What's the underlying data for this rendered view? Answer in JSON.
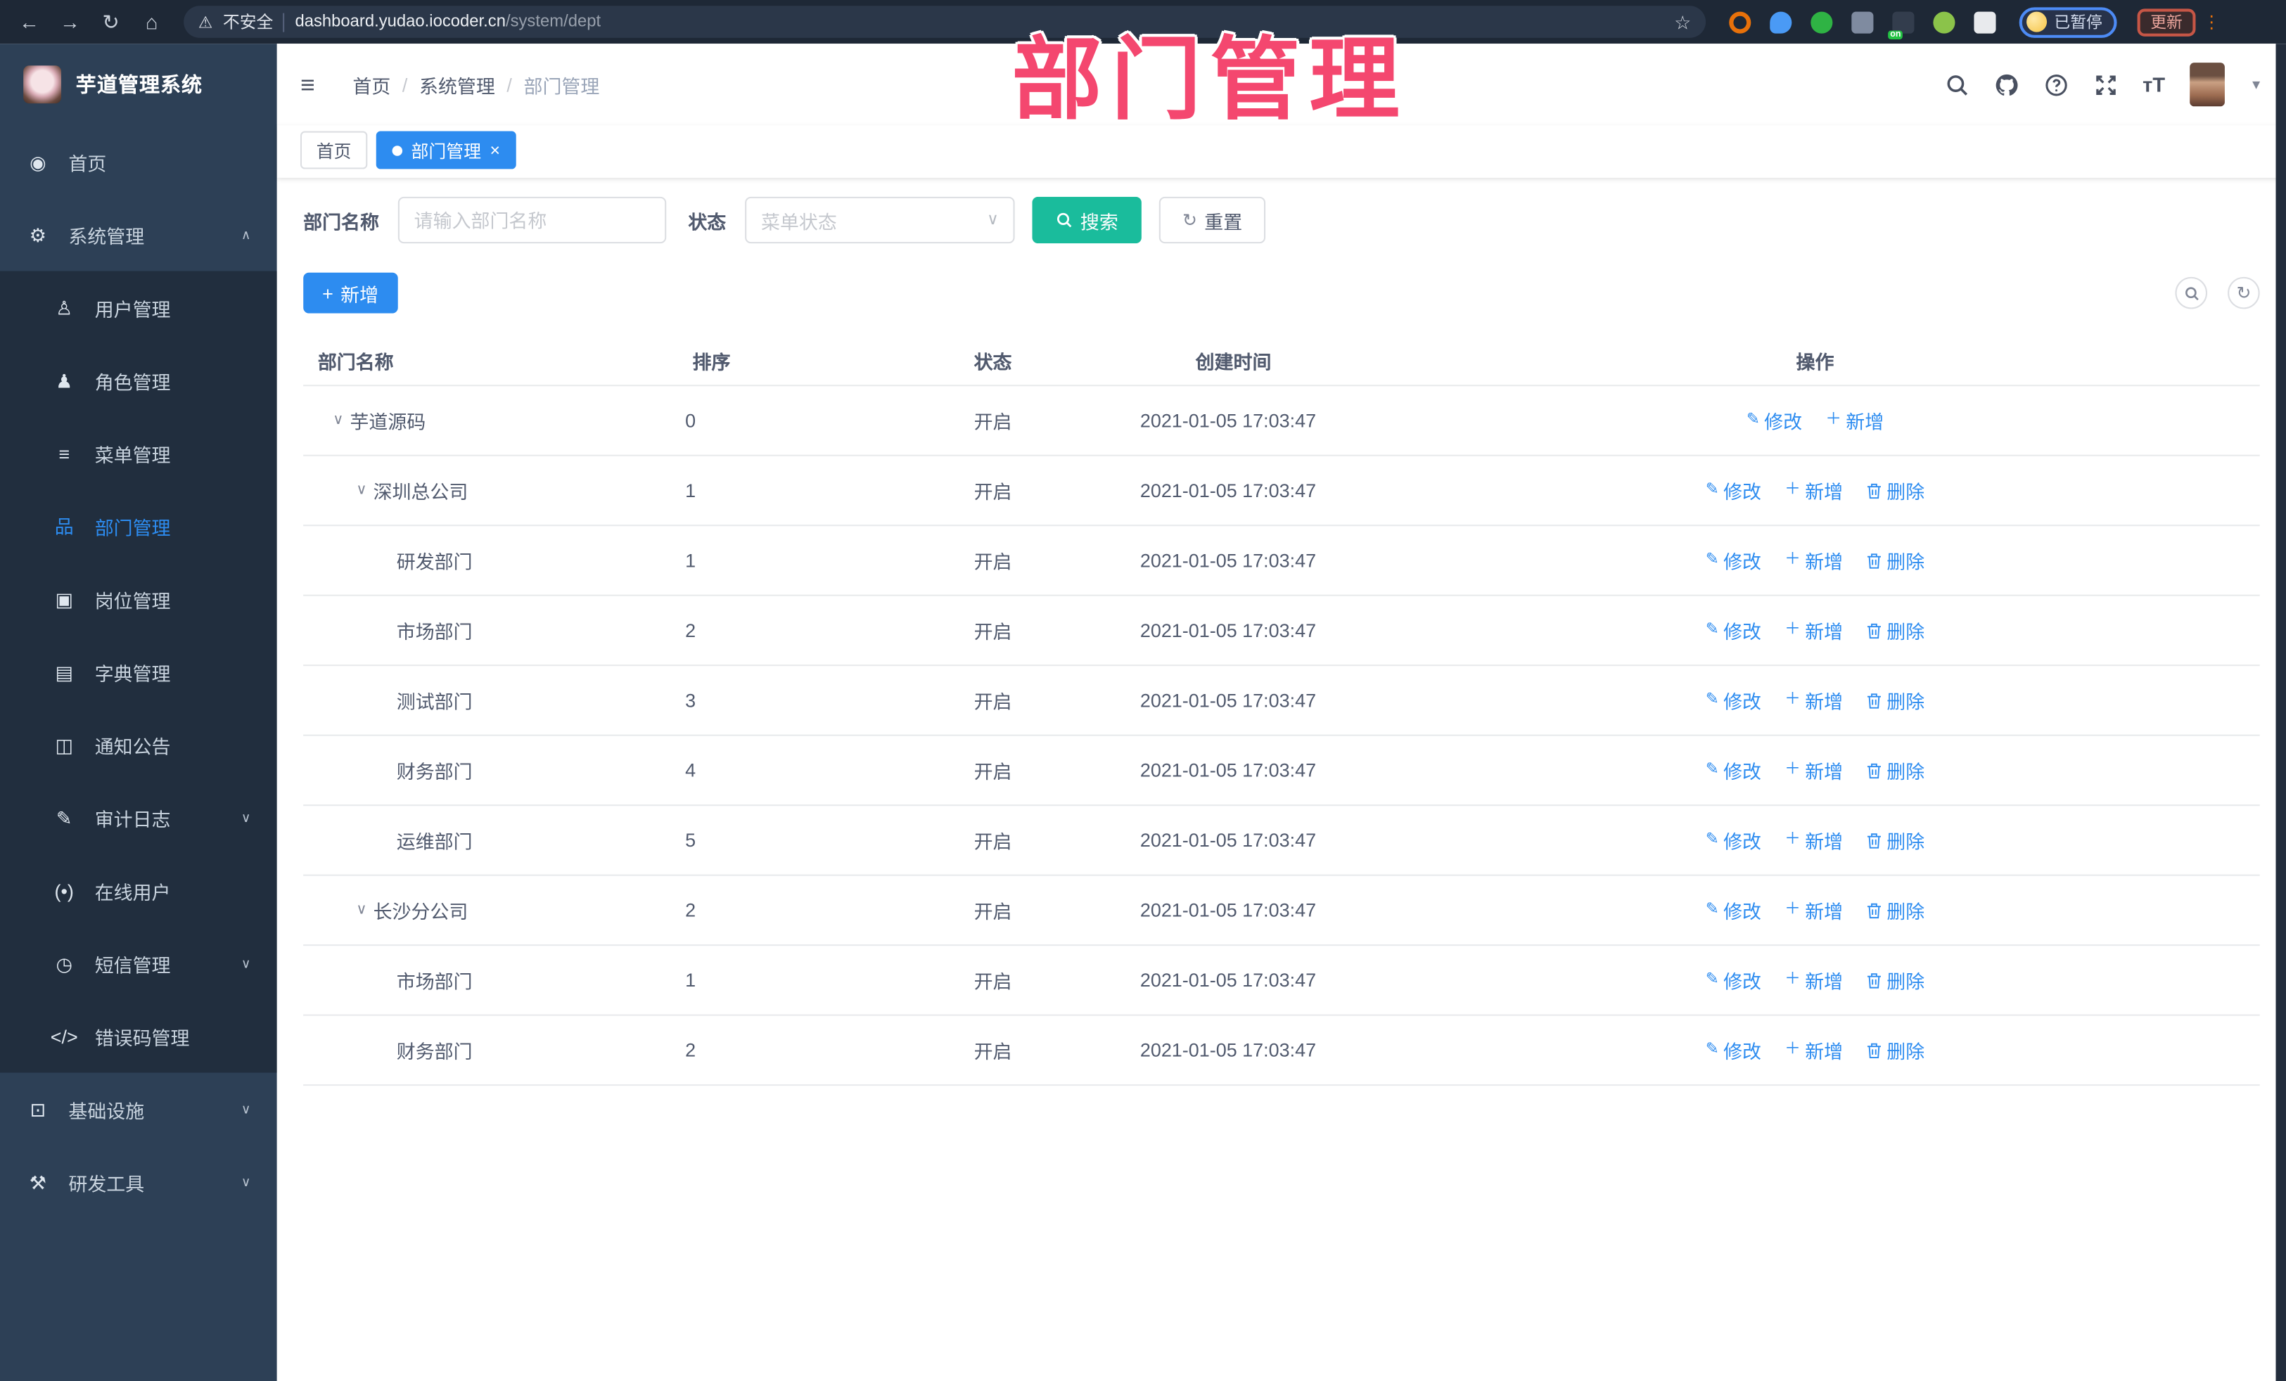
{
  "colors": {
    "accent_blue": "#2d8cf0",
    "search_teal": "#1abc9c",
    "annotation_pink": "#f4476f",
    "sidebar_bg": "#2d4056",
    "submenu_bg": "#212e3e",
    "browser_bar_bg": "#1e2836"
  },
  "annotation": {
    "title": "部门管理"
  },
  "browser": {
    "nav_icons": [
      "back-icon",
      "forward-icon",
      "reload-icon",
      "home-icon"
    ],
    "secure_label": "不安全",
    "url_host": "dashboard.yudao.iocoder.cn",
    "url_path": "/system/dept",
    "bookmark_icon": "star-icon",
    "extensions": [
      {
        "name": "extension-icon-orange-ring",
        "color": "#e8710a",
        "shape": "ring"
      },
      {
        "name": "extension-icon-blue-drop",
        "color": "#4a9af5",
        "shape": "drop"
      },
      {
        "name": "extension-icon-green-check",
        "color": "#2fb344",
        "shape": "circle"
      },
      {
        "name": "extension-icon-grid",
        "color": "#7f8ba0",
        "shape": "square"
      },
      {
        "name": "extension-icon-dark-on",
        "color": "#333d4d",
        "shape": "badge",
        "badge": "on"
      },
      {
        "name": "extension-icon-green-leaf",
        "color": "#8bc34a",
        "shape": "circle"
      },
      {
        "name": "extension-icon-puzzle",
        "color": "#e8eaed",
        "shape": "square"
      }
    ],
    "paused_badge": "已暂停",
    "update_label": "更新"
  },
  "sidebar": {
    "logo_title": "芋道管理系统",
    "items": [
      {
        "name": "home",
        "label": "首页",
        "icon": "dashboard-icon",
        "type": "top"
      },
      {
        "name": "system",
        "label": "系统管理",
        "icon": "gear-icon",
        "type": "top",
        "chevron": "up"
      },
      {
        "name": "user",
        "label": "用户管理",
        "icon": "user-icon",
        "type": "sub"
      },
      {
        "name": "role",
        "label": "角色管理",
        "icon": "role-icon",
        "type": "sub"
      },
      {
        "name": "menu",
        "label": "菜单管理",
        "icon": "menu-list-icon",
        "type": "sub"
      },
      {
        "name": "dept",
        "label": "部门管理",
        "icon": "org-chart-icon",
        "type": "sub",
        "active": true
      },
      {
        "name": "post",
        "label": "岗位管理",
        "icon": "post-icon",
        "type": "sub"
      },
      {
        "name": "dict",
        "label": "字典管理",
        "icon": "dict-icon",
        "type": "sub"
      },
      {
        "name": "notice",
        "label": "通知公告",
        "icon": "announcement-icon",
        "type": "sub"
      },
      {
        "name": "audit-log",
        "label": "审计日志",
        "icon": "audit-log-icon",
        "type": "sub",
        "chevron": "down"
      },
      {
        "name": "online-user",
        "label": "在线用户",
        "icon": "online-user-icon",
        "type": "sub"
      },
      {
        "name": "sms",
        "label": "短信管理",
        "icon": "sms-icon",
        "type": "sub",
        "chevron": "down"
      },
      {
        "name": "error-code",
        "label": "错误码管理",
        "icon": "code-icon",
        "type": "sub"
      },
      {
        "name": "infra",
        "label": "基础设施",
        "icon": "infrastructure-icon",
        "type": "top",
        "chevron": "down"
      },
      {
        "name": "dev-tool",
        "label": "研发工具",
        "icon": "toolbox-icon",
        "type": "top",
        "chevron": "down"
      }
    ]
  },
  "header": {
    "breadcrumb": [
      "首页",
      "系统管理",
      "部门管理"
    ],
    "right_icons": [
      "search-icon",
      "github-icon",
      "help-icon",
      "fullscreen-icon",
      "font-size-icon"
    ]
  },
  "tabs": [
    {
      "label": "首页",
      "active": false,
      "closable": false
    },
    {
      "label": "部门管理",
      "active": true,
      "closable": true
    }
  ],
  "filters": {
    "name_label": "部门名称",
    "name_placeholder": "请输入部门名称",
    "status_label": "状态",
    "status_placeholder": "菜单状态",
    "search_label": "搜索",
    "reset_label": "重置"
  },
  "toolbar": {
    "add_label": "新增",
    "icons": [
      "search-icon",
      "refresh-icon"
    ]
  },
  "table": {
    "columns": [
      "部门名称",
      "排序",
      "状态",
      "创建时间",
      "操作"
    ],
    "rows": [
      {
        "name": "芋道源码",
        "level": 0,
        "expandable": true,
        "order": "0",
        "status": "开启",
        "created": "2021-01-05 17:03:47",
        "actions": [
          {
            "label": "修改",
            "icon": "edit-icon"
          },
          {
            "label": "新增",
            "icon": "plus-icon"
          }
        ]
      },
      {
        "name": "深圳总公司",
        "level": 1,
        "expandable": true,
        "order": "1",
        "status": "开启",
        "created": "2021-01-05 17:03:47",
        "actions": [
          {
            "label": "修改",
            "icon": "edit-icon"
          },
          {
            "label": "新增",
            "icon": "plus-icon"
          },
          {
            "label": "删除",
            "icon": "trash-icon"
          }
        ]
      },
      {
        "name": "研发部门",
        "level": 2,
        "expandable": false,
        "order": "1",
        "status": "开启",
        "created": "2021-01-05 17:03:47",
        "actions": [
          {
            "label": "修改",
            "icon": "edit-icon"
          },
          {
            "label": "新增",
            "icon": "plus-icon"
          },
          {
            "label": "删除",
            "icon": "trash-icon"
          }
        ]
      },
      {
        "name": "市场部门",
        "level": 2,
        "expandable": false,
        "order": "2",
        "status": "开启",
        "created": "2021-01-05 17:03:47",
        "actions": [
          {
            "label": "修改",
            "icon": "edit-icon"
          },
          {
            "label": "新增",
            "icon": "plus-icon"
          },
          {
            "label": "删除",
            "icon": "trash-icon"
          }
        ]
      },
      {
        "name": "测试部门",
        "level": 2,
        "expandable": false,
        "order": "3",
        "status": "开启",
        "created": "2021-01-05 17:03:47",
        "actions": [
          {
            "label": "修改",
            "icon": "edit-icon"
          },
          {
            "label": "新增",
            "icon": "plus-icon"
          },
          {
            "label": "删除",
            "icon": "trash-icon"
          }
        ]
      },
      {
        "name": "财务部门",
        "level": 2,
        "expandable": false,
        "order": "4",
        "status": "开启",
        "created": "2021-01-05 17:03:47",
        "actions": [
          {
            "label": "修改",
            "icon": "edit-icon"
          },
          {
            "label": "新增",
            "icon": "plus-icon"
          },
          {
            "label": "删除",
            "icon": "trash-icon"
          }
        ]
      },
      {
        "name": "运维部门",
        "level": 2,
        "expandable": false,
        "order": "5",
        "status": "开启",
        "created": "2021-01-05 17:03:47",
        "actions": [
          {
            "label": "修改",
            "icon": "edit-icon"
          },
          {
            "label": "新增",
            "icon": "plus-icon"
          },
          {
            "label": "删除",
            "icon": "trash-icon"
          }
        ]
      },
      {
        "name": "长沙分公司",
        "level": 1,
        "expandable": true,
        "order": "2",
        "status": "开启",
        "created": "2021-01-05 17:03:47",
        "actions": [
          {
            "label": "修改",
            "icon": "edit-icon"
          },
          {
            "label": "新增",
            "icon": "plus-icon"
          },
          {
            "label": "删除",
            "icon": "trash-icon"
          }
        ]
      },
      {
        "name": "市场部门",
        "level": 2,
        "expandable": false,
        "order": "1",
        "status": "开启",
        "created": "2021-01-05 17:03:47",
        "actions": [
          {
            "label": "修改",
            "icon": "edit-icon"
          },
          {
            "label": "新增",
            "icon": "plus-icon"
          },
          {
            "label": "删除",
            "icon": "trash-icon"
          }
        ]
      },
      {
        "name": "财务部门",
        "level": 2,
        "expandable": false,
        "order": "2",
        "status": "开启",
        "created": "2021-01-05 17:03:47",
        "actions": [
          {
            "label": "修改",
            "icon": "edit-icon"
          },
          {
            "label": "新增",
            "icon": "plus-icon"
          },
          {
            "label": "删除",
            "icon": "trash-icon"
          }
        ]
      }
    ]
  }
}
